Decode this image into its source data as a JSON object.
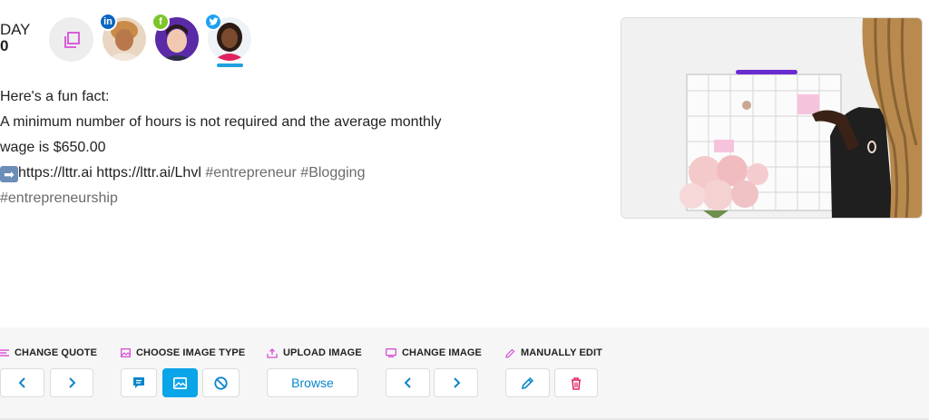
{
  "day": {
    "label": "DAY",
    "number": "0"
  },
  "avatars": [
    {
      "network": "LinkedIn",
      "badge": "in",
      "color": "#0a66c2"
    },
    {
      "network": "Facebook",
      "badge": "f",
      "color": "#7cc52b"
    },
    {
      "network": "Twitter",
      "badge": "",
      "color": "#1da1f2"
    }
  ],
  "post": {
    "line1": "Here's a fun fact:",
    "line2": "A minimum number of hours is not required and the average monthly",
    "line3": "wage is $650.00",
    "emoji": "➡",
    "links": "https://lttr.ai https://lttr.ai/Lhvl",
    "tag1": "#entrepreneur",
    "tag2": "#Blogging",
    "tag3": "#entrepreneurship"
  },
  "toolbar": {
    "change_quote": "CHANGE QUOTE",
    "choose_image_type": "CHOOSE IMAGE TYPE",
    "upload_image": "UPLOAD IMAGE",
    "browse": "Browse",
    "change_image": "CHANGE IMAGE",
    "manually_edit": "MANUALLY EDIT"
  },
  "colors": {
    "accent": "#0aa4e8",
    "magenta": "#d64fd8",
    "delete": "#e0245e"
  }
}
